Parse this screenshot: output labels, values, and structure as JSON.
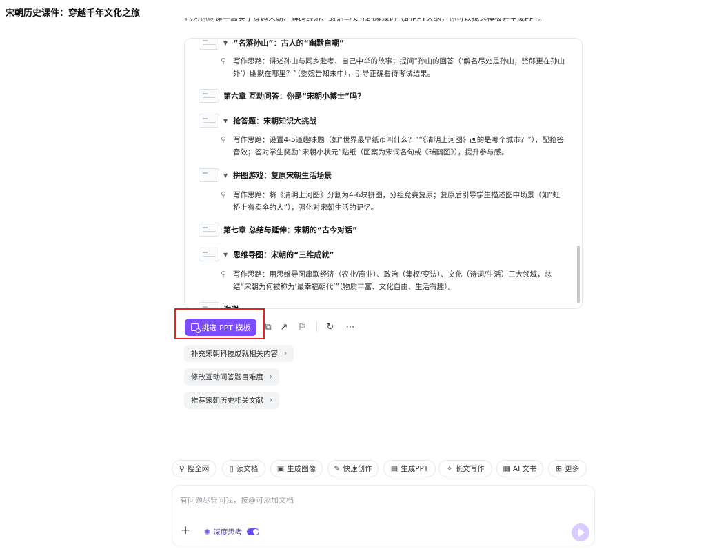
{
  "page": {
    "title": "宋朝历史课件：穿越千年文化之旅",
    "cut_text": "已为你创建一篇关于穿越宋朝、解码经济、政治与文化的璀璨时代的PPT大纲，你可以挑选模板并生成PPT。"
  },
  "outline": {
    "rows": [
      {
        "kind": "section",
        "label": "“名落孙山”：古人的“幽默自嘲”"
      },
      {
        "kind": "idea",
        "text": "写作思路：讲述孙山与同乡赴考、自己中举的故事；提问“孙山的回答（‘解名尽处是孙山，贤郎更在孙山外’）幽默在哪里？”（委婉告知未中），引导正确看待考试结果。"
      },
      {
        "kind": "chapter",
        "label": "第六章 互动问答：你是“宋朝小博士”吗？"
      },
      {
        "kind": "section",
        "label": "抢答题：宋朝知识大挑战"
      },
      {
        "kind": "idea",
        "text": "写作思路：设置4-5道趣味题（如“世界最早纸币叫什么？”“《清明上河图》画的是哪个城市？”），配抢答音效；答对学生奖励“宋朝小状元”贴纸（图案为宋词名句或《瑞鹤图》），提升参与感。"
      },
      {
        "kind": "section",
        "label": "拼图游戏：复原宋朝生活场景"
      },
      {
        "kind": "idea",
        "text": "写作思路：将《清明上河图》分割为4-6块拼图，分组竞赛复原；复原后引导学生描述图中场景（如“虹桥上有卖伞的人”），强化对宋朝生活的记忆。"
      },
      {
        "kind": "chapter",
        "label": "第七章 总结与延伸：宋朝的“古今对话”"
      },
      {
        "kind": "section",
        "label": "思维导图：宋朝的“三维成就”"
      },
      {
        "kind": "idea",
        "text": "写作思路：用思维导图串联经济（农业/商业）、政治（集权/变法）、文化（诗词/生活）三大领域，总结“宋朝为何被称为‘最幸福朝代’”（物质丰富、文化自由、生活有趣）。"
      },
      {
        "kind": "chapter",
        "label": "谢谢"
      }
    ]
  },
  "actions": {
    "pick_template_label": "挑选 PPT 模板",
    "icons": [
      "copy-icon",
      "share-icon",
      "bookmark-icon",
      "refresh-icon",
      "more-icon"
    ]
  },
  "suggestions": [
    {
      "label": "补充宋朝科技成就相关内容"
    },
    {
      "label": "修改互动问答题目难度"
    },
    {
      "label": "推荐宋朝历史相关文献"
    }
  ],
  "tools": [
    {
      "label": "搜全网",
      "icon": "search-icon"
    },
    {
      "label": "读文档",
      "icon": "book-icon"
    },
    {
      "label": "生成图像",
      "icon": "image-icon"
    },
    {
      "label": "快速创作",
      "icon": "pen-icon"
    },
    {
      "label": "生成PPT",
      "icon": "ppt-icon"
    },
    {
      "label": "长文写作",
      "icon": "feather-icon"
    },
    {
      "label": "AI 文书",
      "icon": "document-icon"
    },
    {
      "label": "更多",
      "icon": "grid-icon"
    }
  ],
  "composer": {
    "placeholder": "有问题尽管问我，按@可添加文档",
    "deep_think_label": "深度思考",
    "deep_think_on": true
  },
  "colors": {
    "accent": "#7b4dff",
    "highlight_box": "#e8231d",
    "send_disabled": "#d9ccff"
  }
}
